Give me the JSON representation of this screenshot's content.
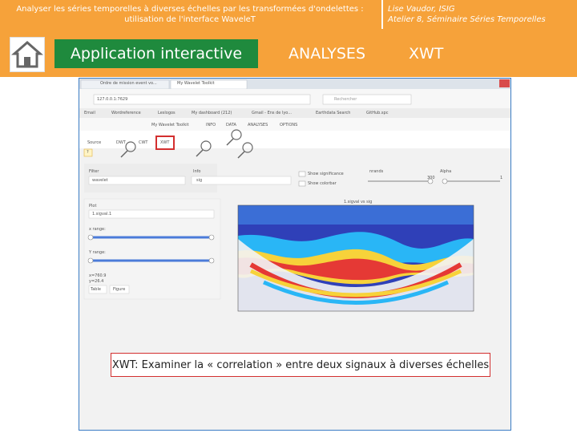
{
  "header": {
    "title_line1": "Analyser les séries temporelles à diverses échelles par les transformées d'ondelettes :",
    "title_line2": "utilisation de l'interface WaveleT",
    "author": "Lise Vaudor, ISIG",
    "event": "Atelier 8, Séminaire Séries Temporelles"
  },
  "nav": {
    "app_label": "Application interactive",
    "analyses_label": "ANALYSES",
    "xwt_label": "XWT"
  },
  "browser": {
    "tab1": "Ordre de mission event vo...",
    "tab2": "My Wavelet Toolkit",
    "url": "127.0.0.1:7629",
    "search_placeholder": "Rechercher",
    "bookmarks": [
      "Email",
      "Wordreference",
      "Leslogos",
      "My dashboard (212)",
      "Gmail - Ens de lyo...",
      "Earthdata Search",
      "GitHub.spc"
    ]
  },
  "app": {
    "title": "My Wavelet Toolkit",
    "nav_items": [
      "INFO",
      "DATA",
      "ANALYSES",
      "OPTIONS"
    ],
    "analysis_tabs": [
      "Source",
      "DWT",
      "CWT",
      "XWT"
    ],
    "help": "?",
    "filter_label": "Filter",
    "filter_value": "wavelet",
    "info_label": "Info",
    "info_value": "sig",
    "show_significance": "Show significance",
    "show_colorbar": "Show colorbar",
    "nrands_label": "nrands",
    "nrands_value": "300",
    "alpha_label": "Alpha",
    "alpha_value": "1",
    "plot_label": "Plot",
    "plot_value": "1.sigval.1",
    "x_range_label": "x range:",
    "y_range_label": "Y range:",
    "x_readout": "x=760.9",
    "y_readout": "y=26.4",
    "table_btn": "Table",
    "figure_btn": "Figure",
    "plot_title": "1.sigval vs sig"
  },
  "caption": "XWT: Examiner la « correlation » entre deux signaux à diverses échelles",
  "colors": {
    "orange": "#f6a23a",
    "green": "#1f8a3d",
    "red": "#d32f2f"
  }
}
